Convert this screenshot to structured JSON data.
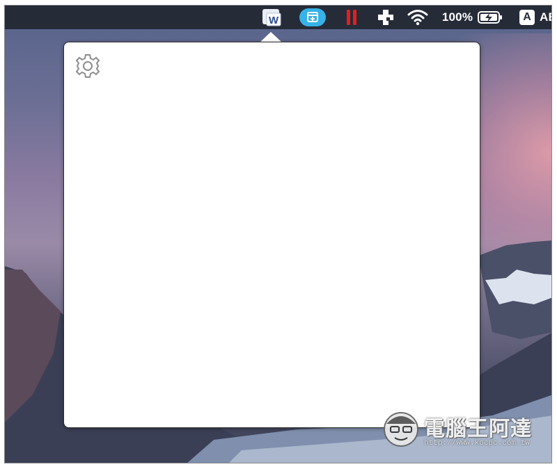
{
  "menubar": {
    "word_label": "W",
    "battery_percent": "100%",
    "input_source": "A",
    "input_source_more": "AE"
  },
  "colors": {
    "menubar_bg": "#262b38",
    "teal_accent": "#36b2e8",
    "red_accent": "#e02020",
    "popover_bg": "#ffffff"
  },
  "icons": {
    "word": "word-app-icon",
    "teal": "screen-share-icon",
    "pause": "pause-icon",
    "medical": "plus-icon",
    "wifi": "wifi-icon",
    "battery": "battery-charging-icon",
    "gear": "gear-icon"
  },
  "watermark": {
    "title": "電腦王阿達",
    "url": "http://www.kocpc.com.tw"
  }
}
